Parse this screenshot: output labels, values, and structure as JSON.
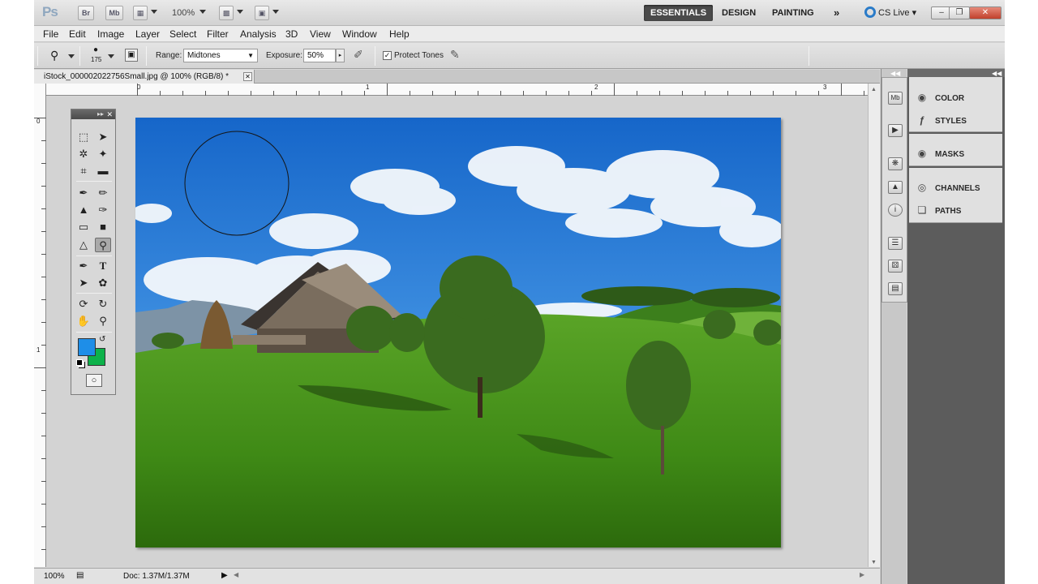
{
  "app": {
    "logo": "Ps",
    "bridge_btn": "Br",
    "minibridge_btn": "Mb",
    "zoom": "100%",
    "workspaces": [
      "ESSENTIALS",
      "DESIGN",
      "PAINTING"
    ],
    "more_workspaces": "»",
    "cs_live": "CS Live"
  },
  "menu": [
    "File",
    "Edit",
    "Image",
    "Layer",
    "Select",
    "Filter",
    "Analysis",
    "3D",
    "View",
    "Window",
    "Help"
  ],
  "options": {
    "brush_size": "175",
    "range_label": "Range:",
    "range_value": "Midtones",
    "exposure_label": "Exposure:",
    "exposure_value": "50%",
    "protect_tones_label": "Protect Tones",
    "protect_tones_checked": true
  },
  "document": {
    "tab_title": "iStock_000002022756Small.jpg @ 100% (RGB/8) *",
    "ruler_top": [
      "0",
      "1",
      "2",
      "3"
    ],
    "ruler_left": [
      "0",
      "1"
    ]
  },
  "tools": {
    "foreground_color": "#1e8ee8",
    "background_color": "#0db24a"
  },
  "status": {
    "zoom": "100%",
    "doc_info": "Doc: 1.37M/1.37M"
  },
  "panels": {
    "group1": [
      "COLOR",
      "STYLES"
    ],
    "group2": [
      "MASKS"
    ],
    "group3": [
      "CHANNELS",
      "PATHS"
    ]
  }
}
